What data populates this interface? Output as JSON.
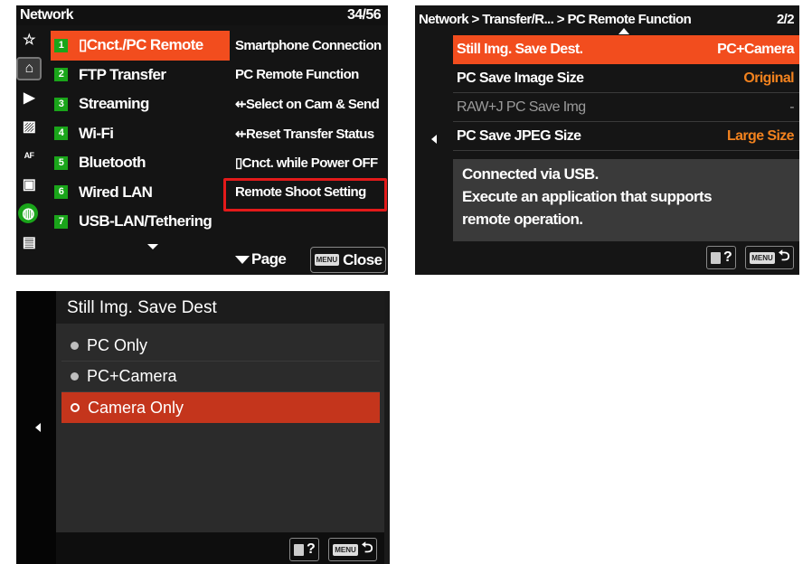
{
  "panel1": {
    "title": "Network",
    "page": "34/56",
    "icons": [
      "star-icon",
      "home-icon",
      "camera-play-icon",
      "photo-edit-icon",
      "af-mf-icon",
      "playback-icon",
      "network-globe-icon",
      "toolbox-icon"
    ],
    "menu": [
      {
        "num": "1",
        "label": "▯Cnct./PC Remote"
      },
      {
        "num": "2",
        "label": "FTP Transfer"
      },
      {
        "num": "3",
        "label": "Streaming"
      },
      {
        "num": "4",
        "label": "Wi-Fi"
      },
      {
        "num": "5",
        "label": "Bluetooth"
      },
      {
        "num": "6",
        "label": "Wired LAN"
      },
      {
        "num": "7",
        "label": "USB-LAN/Tethering"
      }
    ],
    "submenu": [
      "Smartphone Connection",
      "PC Remote Function",
      "⇷Select on Cam & Send",
      "⇷Reset Transfer Status",
      "▯Cnct. while Power OFF",
      "Remote Shoot Setting"
    ],
    "footer": {
      "page_label": "Page",
      "menu_chip": "MENU",
      "close_label": "Close"
    }
  },
  "panel2": {
    "breadcrumb": "Network > Transfer/R...   > PC Remote Function",
    "page": "2/2",
    "rows": [
      {
        "label": "Still Img. Save Dest.",
        "value": "PC+Camera"
      },
      {
        "label": "PC Save Image Size",
        "value": "Original"
      },
      {
        "label": "RAW+J PC Save Img",
        "value": "-"
      },
      {
        "label": "PC Save JPEG Size",
        "value": "Large Size"
      }
    ],
    "message": [
      "Connected via USB.",
      "Execute an application that supports",
      "remote operation."
    ],
    "footer": {
      "help": "?",
      "menu_chip": "MENU",
      "return": "⮌"
    }
  },
  "panel3": {
    "title": "Still Img. Save Dest",
    "options": [
      "PC Only",
      "PC+Camera",
      "Camera Only"
    ],
    "footer": {
      "help": "?",
      "menu_chip": "MENU",
      "return": "⮌"
    }
  },
  "colors": {
    "accent": "#f24d1e",
    "selected_option": "#c4351c",
    "value_orange": "#f2821e",
    "highlight_box": "#e31a1a",
    "number_badge": "#1aa51a"
  }
}
